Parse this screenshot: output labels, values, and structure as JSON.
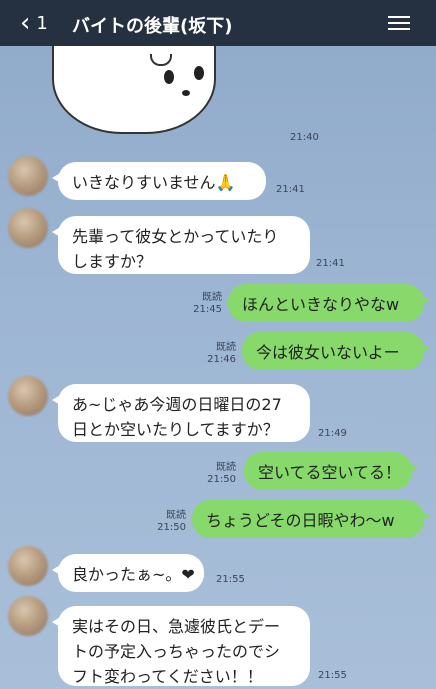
{
  "header": {
    "back_count": "1",
    "title": "バイトの後輩(坂下)"
  },
  "sticker": {
    "time": "21:40"
  },
  "messages": [
    {
      "side": "in",
      "lines": [
        "いきなりすいません🙏"
      ],
      "time": "21:41"
    },
    {
      "side": "in",
      "lines": [
        "先輩って彼女とかっていたり",
        "しますか？"
      ],
      "time": "21:41"
    },
    {
      "side": "out",
      "lines": [
        "ほんといきなりやなw"
      ],
      "read": "既読",
      "time": "21:45"
    },
    {
      "side": "out",
      "lines": [
        "今は彼女いないよー"
      ],
      "read": "既読",
      "time": "21:46"
    },
    {
      "side": "in",
      "lines": [
        "あ~じゃあ今週の日曜日の27",
        "日とか空いたりしてますか？"
      ],
      "time": "21:49"
    },
    {
      "side": "out",
      "lines": [
        "空いてる空いてる！"
      ],
      "read": "既読",
      "time": "21:50"
    },
    {
      "side": "out",
      "lines": [
        "ちょうどその日暇やわ〜w"
      ],
      "read": "既読",
      "time": "21:50"
    },
    {
      "side": "in",
      "lines": [
        "良かったぁ~。❤"
      ],
      "time": "21:55"
    },
    {
      "side": "in",
      "lines": [
        "実はその日、急遽彼氏とデー",
        "トの予定入っちゃったのでシ",
        "フト変わってください！！"
      ],
      "time": "21:55"
    }
  ]
}
